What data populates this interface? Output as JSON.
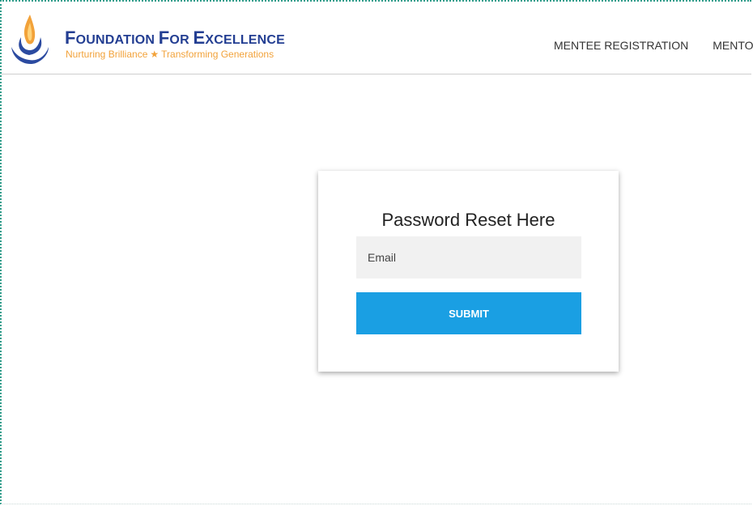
{
  "brand": {
    "title_f1": "F",
    "title_w1": "OUNDATION ",
    "title_f2": "F",
    "title_w2": "OR ",
    "title_f3": "E",
    "title_w3": "XCELLENCE",
    "tagline_left": "Nurturing Brilliance",
    "tagline_star": "★",
    "tagline_right": "Transforming Generations",
    "logo_icon": "flame-in-hands-icon",
    "colors": {
      "title": "#233e92",
      "tagline": "#f2a23a",
      "flame": "#f2a23a",
      "hands": "#2b4aa0"
    }
  },
  "nav": {
    "items": [
      {
        "label": "MENTEE REGISTRATION"
      },
      {
        "label": "MENTOR REGISTRATION"
      }
    ]
  },
  "reset_form": {
    "title": "Password Reset Here",
    "email_placeholder": "Email",
    "email_value": "",
    "submit_label": "SUBMIT",
    "submit_color": "#1a9fe3"
  }
}
